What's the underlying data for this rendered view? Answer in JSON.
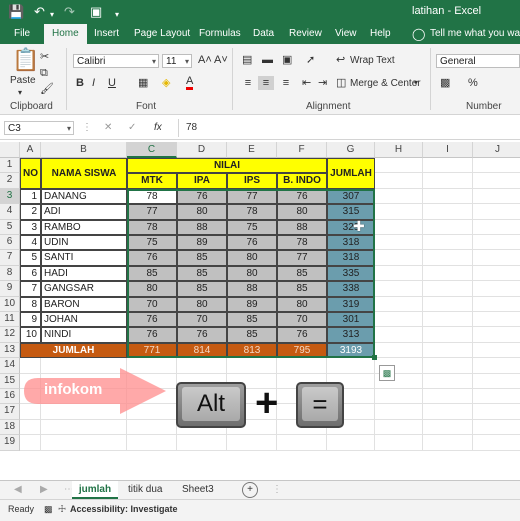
{
  "title_bar": {
    "file_name": "latihan",
    "app_name": "Excel",
    "separator": "-"
  },
  "ribbon_tabs": [
    "File",
    "Home",
    "Insert",
    "Page Layout",
    "Formulas",
    "Data",
    "Review",
    "View",
    "Help"
  ],
  "active_tab": "Home",
  "tell_me": "Tell me what you want t",
  "ribbon": {
    "clipboard": {
      "paste_label": "Paste",
      "group_label": "Clipboard"
    },
    "font": {
      "font_name": "Calibri",
      "font_size": "11",
      "group_label": "Font",
      "bold": "B",
      "italic": "I",
      "underline": "U",
      "grow": "A˄",
      "shrink": "A˅",
      "font_color": "A"
    },
    "alignment": {
      "wrap_text": "Wrap Text",
      "merge_center": "Merge & Center",
      "group_label": "Alignment"
    },
    "number": {
      "format": "General",
      "group_label": "Number"
    }
  },
  "formula_bar": {
    "name_box": "C3",
    "fx": "fx",
    "value": "78",
    "cancel": "✕",
    "enter": "✓"
  },
  "columns": [
    "A",
    "B",
    "C",
    "D",
    "E",
    "F",
    "G",
    "H",
    "I",
    "J"
  ],
  "selected_column": "C",
  "rows": [
    "1",
    "2",
    "3",
    "4",
    "5",
    "6",
    "7",
    "8",
    "9",
    "10",
    "11",
    "12",
    "13",
    "14",
    "15",
    "16",
    "17",
    "18",
    "19"
  ],
  "selected_row": "3",
  "table": {
    "header_no": "NO",
    "header_name": "NAMA SISWA",
    "header_nilai": "NILAI",
    "header_jumlah": "JUMLAH",
    "subjects": [
      "MTK",
      "IPA",
      "IPS",
      "B. INDO"
    ],
    "students": [
      {
        "no": "1",
        "name": "DANANG",
        "scores": [
          "78",
          "76",
          "77",
          "76"
        ],
        "total": "307"
      },
      {
        "no": "2",
        "name": "ADI",
        "scores": [
          "77",
          "80",
          "78",
          "80"
        ],
        "total": "315"
      },
      {
        "no": "3",
        "name": "RAMBO",
        "scores": [
          "78",
          "88",
          "75",
          "88"
        ],
        "total": "329"
      },
      {
        "no": "4",
        "name": "UDIN",
        "scores": [
          "75",
          "89",
          "76",
          "78"
        ],
        "total": "318"
      },
      {
        "no": "5",
        "name": "SANTI",
        "scores": [
          "76",
          "85",
          "80",
          "77"
        ],
        "total": "318"
      },
      {
        "no": "6",
        "name": "HADI",
        "scores": [
          "85",
          "85",
          "80",
          "85"
        ],
        "total": "335"
      },
      {
        "no": "7",
        "name": "GANGSAR",
        "scores": [
          "80",
          "85",
          "88",
          "85"
        ],
        "total": "338"
      },
      {
        "no": "8",
        "name": "BARON",
        "scores": [
          "70",
          "80",
          "89",
          "80"
        ],
        "total": "319"
      },
      {
        "no": "9",
        "name": "JOHAN",
        "scores": [
          "76",
          "70",
          "85",
          "70"
        ],
        "total": "301"
      },
      {
        "no": "10",
        "name": "NINDI",
        "scores": [
          "76",
          "76",
          "85",
          "76"
        ],
        "total": "313"
      }
    ],
    "footer_label": "JUMLAH",
    "footer_totals": [
      "771",
      "814",
      "813",
      "795"
    ],
    "footer_grand": "3193"
  },
  "overlay": {
    "watermark": "infokom",
    "key_alt": "Alt",
    "plus": "+",
    "key_equals": "="
  },
  "sheet_tabs": [
    "jumlah",
    "titik dua",
    "Sheet3"
  ],
  "active_sheet": "jumlah",
  "status": {
    "ready": "Ready",
    "accessibility": "Accessibility: Investigate"
  },
  "colors": {
    "excel_green": "#217346",
    "header_yellow": "#ffff00",
    "score_gray": "#c0c0c0",
    "total_teal": "#6b9dad",
    "footer_orange": "#c55a11"
  }
}
